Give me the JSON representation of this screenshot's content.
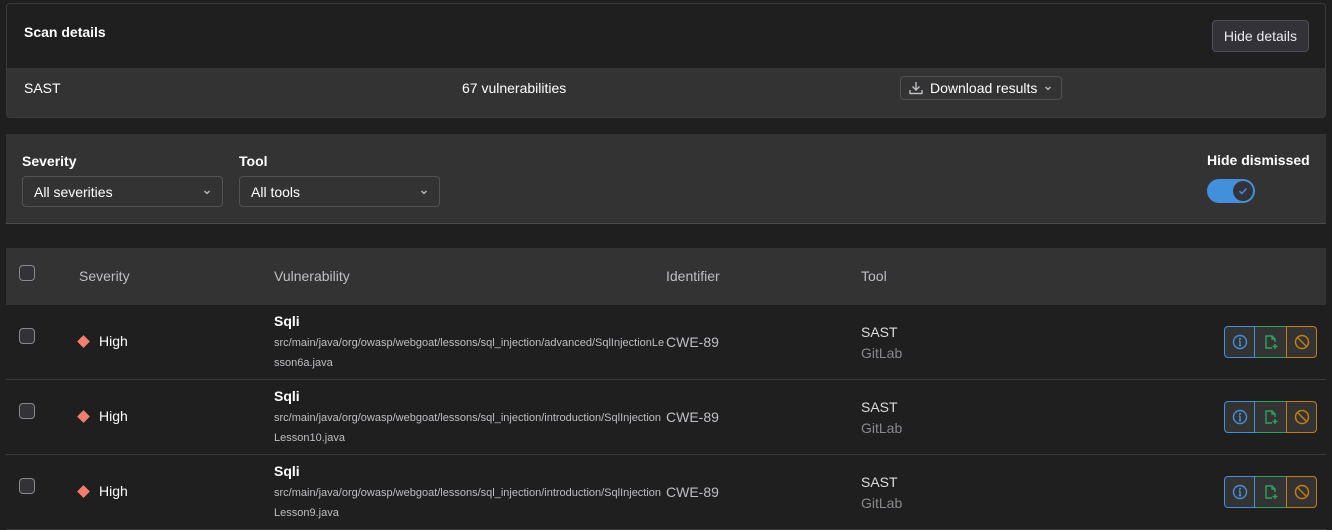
{
  "scan_details": {
    "title": "Scan details",
    "hide_details_label": "Hide details",
    "tool": "SAST",
    "vulnerability_count": "67 vulnerabilities",
    "download_label": "Download results"
  },
  "filters": {
    "severity": {
      "label": "Severity",
      "selected": "All severities"
    },
    "tool": {
      "label": "Tool",
      "selected": "All tools"
    },
    "hide_dismissed": {
      "label": "Hide dismissed",
      "enabled": true
    }
  },
  "table": {
    "headers": {
      "severity": "Severity",
      "vulnerability": "Vulnerability",
      "identifier": "Identifier",
      "tool": "Tool"
    },
    "rows": [
      {
        "severity": "High",
        "title": "Sqli",
        "path": "src/main/java/org/owasp/webgoat/lessons/sql_injection/advanced/SqlInjectionLesson6a.java",
        "identifier": "CWE-89",
        "tool": "SAST",
        "vendor": "GitLab"
      },
      {
        "severity": "High",
        "title": "Sqli",
        "path": "src/main/java/org/owasp/webgoat/lessons/sql_injection/introduction/SqlInjectionLesson10.java",
        "identifier": "CWE-89",
        "tool": "SAST",
        "vendor": "GitLab"
      },
      {
        "severity": "High",
        "title": "Sqli",
        "path": "src/main/java/org/owasp/webgoat/lessons/sql_injection/introduction/SqlInjectionLesson9.java",
        "identifier": "CWE-89",
        "tool": "SAST",
        "vendor": "GitLab"
      }
    ]
  },
  "icons": {
    "download": "download-icon",
    "chevron": "chevron-down-icon",
    "check": "check-icon",
    "severity_high": "severity-high-icon",
    "info": "info-icon",
    "create_issue": "issue-new-icon",
    "dismiss": "cancel-icon"
  },
  "colors": {
    "severity_high": "#f57f6c",
    "toggle_on": "#428fdc",
    "info_action": "#428fdc",
    "issue_action": "#2da160",
    "dismiss_action": "#c17d10"
  }
}
